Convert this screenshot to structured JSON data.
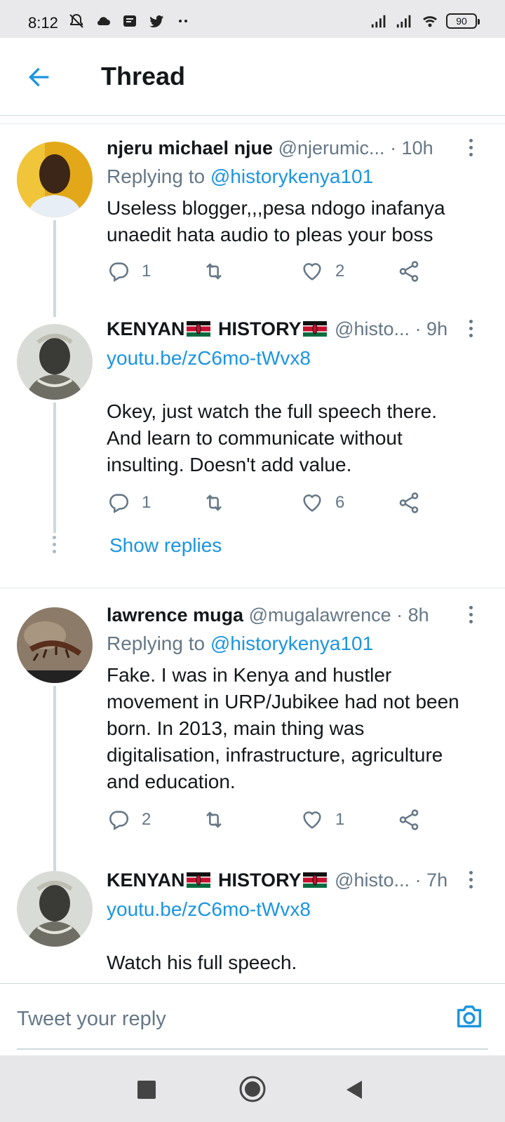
{
  "status_bar": {
    "time": "8:12",
    "battery": "90"
  },
  "header": {
    "title": "Thread"
  },
  "tweets": [
    {
      "name": "njeru michael njue",
      "handle": "@njerumic...",
      "time": "· 10h",
      "replying_prefix": "Replying to ",
      "replying_handle": "@historykenya101",
      "text_lines": [
        "Useless blogger,,,pesa ndogo inafanya",
        "unaedit hata audio to pleas your boss"
      ],
      "replies": "1",
      "retweets": "",
      "likes": "2"
    },
    {
      "name_a": "KENYAN",
      "name_b": " HISTORY",
      "handle": "@histo...",
      "time": "· 9h",
      "link": "youtu.be/zC6mo-tWvx8",
      "text_lines": [
        "Okey, just watch the full speech there.",
        "And learn to communicate without",
        "insulting. Doesn't add value."
      ],
      "replies": "1",
      "retweets": "",
      "likes": "6",
      "show_replies": "Show replies"
    },
    {
      "name": "lawrence muga",
      "handle": "@mugalawrence",
      "time": "· 8h",
      "replying_prefix": "Replying to ",
      "replying_handle": "@historykenya101",
      "text_lines": [
        "Fake. I was in Kenya and hustler",
        "movement in URP/Jubikee had not been",
        "born. In 2013, main thing was",
        "digitalisation, infrastructure, agriculture",
        "and education."
      ],
      "replies": "2",
      "retweets": "",
      "likes": "1"
    },
    {
      "name_a": "KENYAN",
      "name_b": " HISTORY",
      "handle": "@histo...",
      "time": "· 7h",
      "link": "youtu.be/zC6mo-tWvx8",
      "text_lines": [
        "Watch his full speech."
      ]
    }
  ],
  "reply_box": {
    "placeholder": "Tweet your reply"
  },
  "colors": {
    "accent": "#1b95e0",
    "muted": "#657786",
    "text": "#14171a"
  },
  "icons": [
    "back-arrow-icon",
    "reply-icon",
    "retweet-icon",
    "like-icon",
    "share-icon",
    "camera-icon",
    "more-icon"
  ]
}
